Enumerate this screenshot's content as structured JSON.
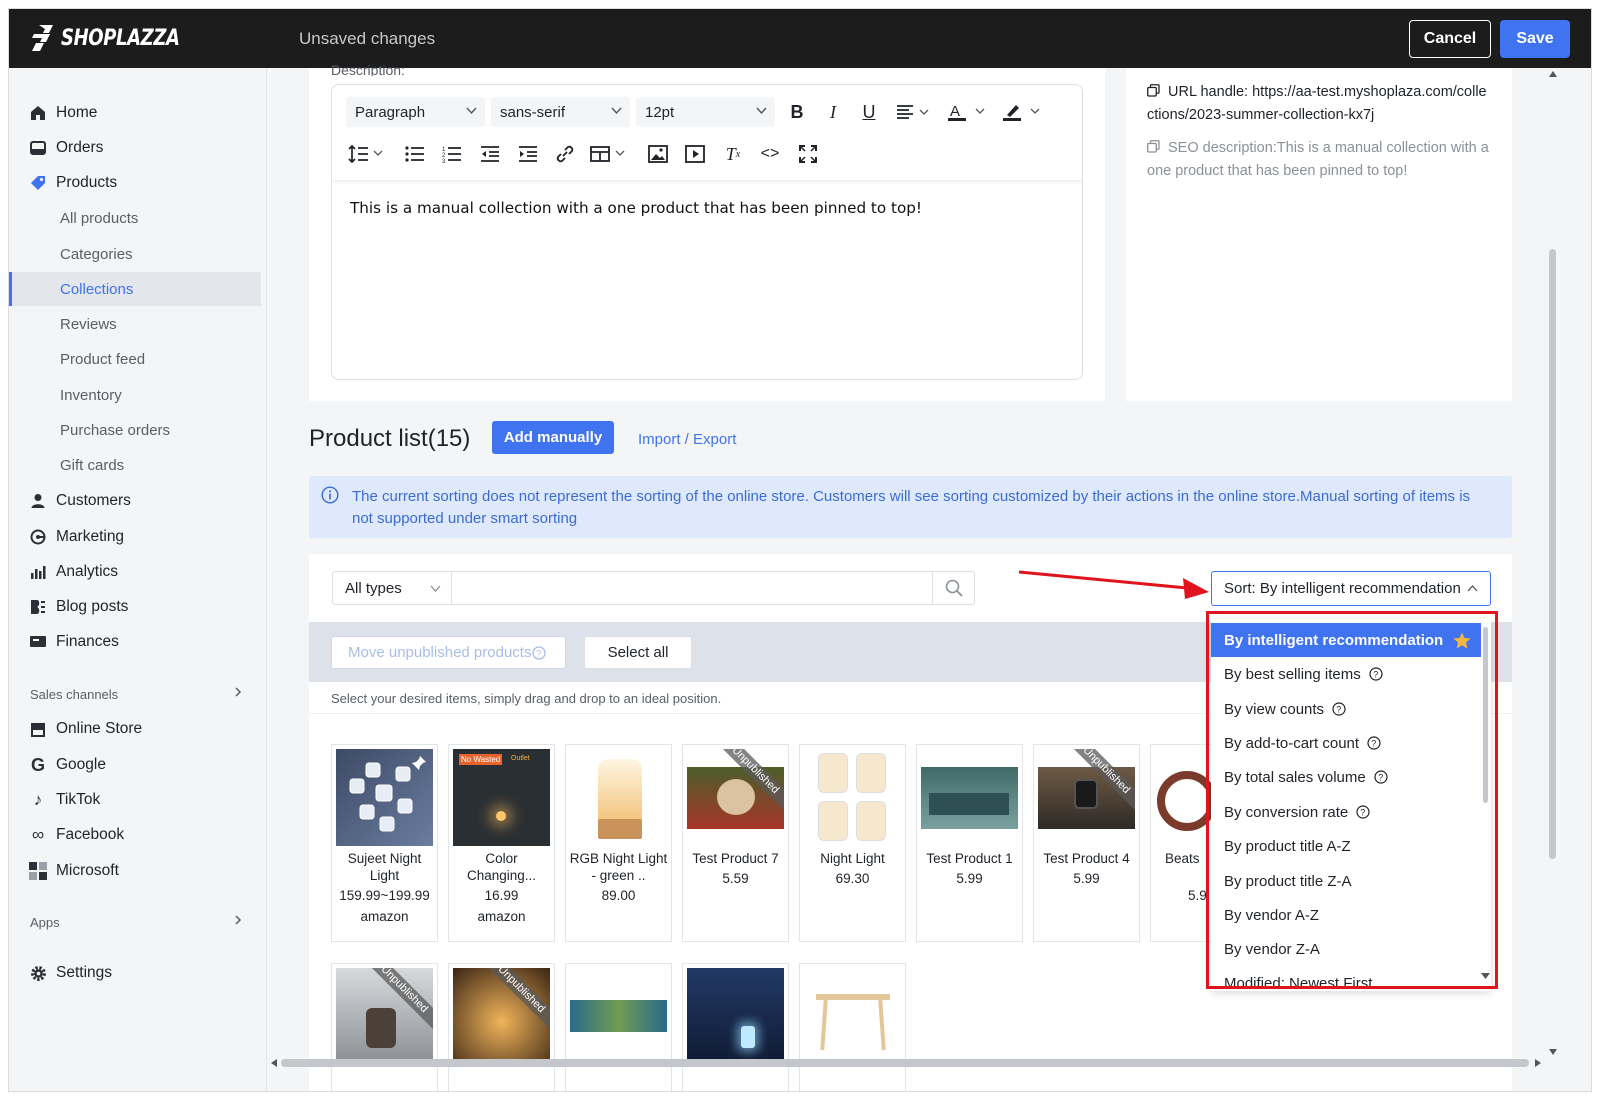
{
  "topbar": {
    "brand": "SHOPLAZZA",
    "status": "Unsaved changes",
    "cancel_label": "Cancel",
    "save_label": "Save"
  },
  "sidebar": {
    "items": [
      {
        "label": "Home",
        "icon": "home-icon"
      },
      {
        "label": "Orders",
        "icon": "orders-icon"
      },
      {
        "label": "Products",
        "icon": "tag-icon"
      }
    ],
    "product_sub": [
      "All products",
      "Categories",
      "Collections",
      "Reviews",
      "Product feed",
      "Inventory",
      "Purchase orders",
      "Gift cards"
    ],
    "active_sub": "Collections",
    "items2": [
      {
        "label": "Customers",
        "icon": "person-icon"
      },
      {
        "label": "Marketing",
        "icon": "marketing-icon"
      },
      {
        "label": "Analytics",
        "icon": "analytics-icon"
      },
      {
        "label": "Blog posts",
        "icon": "blog-icon"
      },
      {
        "label": "Finances",
        "icon": "finance-icon"
      }
    ],
    "sales_channels_label": "Sales channels",
    "channels": [
      {
        "label": "Online Store",
        "icon": "store-icon"
      },
      {
        "label": "Google",
        "icon": "google-icon"
      },
      {
        "label": "TikTok",
        "icon": "tiktok-icon"
      },
      {
        "label": "Facebook",
        "icon": "meta-icon"
      },
      {
        "label": "Microsoft",
        "icon": "microsoft-icon"
      }
    ],
    "apps_label": "Apps",
    "settings_label": "Settings"
  },
  "editor": {
    "description_label": "Description:",
    "block_format": "Paragraph",
    "font_family": "sans-serif",
    "font_size": "12pt",
    "content": "This is a manual collection with a one product that has been pinned to top!"
  },
  "seo": {
    "url_handle": "URL handle: https://aa-test.myshoplaza.com/collections/2023-summer-collection-kx7j",
    "seo_description": "SEO description:This is a manual collection with a one product that has been pinned to top!"
  },
  "product_list": {
    "title": "Product list(15)",
    "add_manually": "Add manually",
    "import_export": "Import / Export",
    "info": "The current sorting does not represent the sorting of the online store. Customers will see sorting customized by their actions in the online store.Manual sorting of items is not supported under smart sorting",
    "type_filter": "All types",
    "search_placeholder": "",
    "sort_label": "Sort: By intelligent recommendation",
    "move_unpublished": "Move unpublished products",
    "select_all": "Select all",
    "hint": "Select your desired items, simply drag and drop to an ideal position.",
    "unpublished_label": "Unpublished",
    "no_wasted_label": "No Wasted",
    "no_wasted_tag": "Outlet",
    "products": [
      {
        "name": "Sujeet Night Light",
        "price": "159.99~199.99",
        "vendor": "amazon"
      },
      {
        "name": "Color Changing...",
        "price": "16.99",
        "vendor": "amazon"
      },
      {
        "name": "RGB Night Light - green ..",
        "price": "89.00",
        "vendor": ""
      },
      {
        "name": "Test Product 7",
        "price": "5.59",
        "vendor": ""
      },
      {
        "name": "Night Light",
        "price": "69.30",
        "vendor": ""
      },
      {
        "name": "Test Product 1",
        "price": "5.99",
        "vendor": ""
      },
      {
        "name": "Test Product 4",
        "price": "5.99",
        "vendor": ""
      },
      {
        "name": "Beats",
        "price": "5.9",
        "vendor": ""
      }
    ]
  },
  "sort_options": [
    {
      "label": "By intelligent recommendation",
      "selected": true,
      "star": true,
      "help": false
    },
    {
      "label": "By best selling items",
      "selected": false,
      "help": true
    },
    {
      "label": "By view counts",
      "selected": false,
      "help": true
    },
    {
      "label": "By add-to-cart count",
      "selected": false,
      "help": true
    },
    {
      "label": "By total sales volume",
      "selected": false,
      "help": true
    },
    {
      "label": "By conversion rate",
      "selected": false,
      "help": true
    },
    {
      "label": "By product title A-Z",
      "selected": false,
      "help": false
    },
    {
      "label": "By product title Z-A",
      "selected": false,
      "help": false
    },
    {
      "label": "By vendor A-Z",
      "selected": false,
      "help": false
    },
    {
      "label": "By vendor Z-A",
      "selected": false,
      "help": false
    },
    {
      "label": "Modified: Newest First",
      "selected": false,
      "help": false
    }
  ],
  "colors": {
    "accent": "#3f73f0",
    "topbar": "#1c1c1c",
    "highlight": "#e0141c",
    "info_bg": "#dfe9fd"
  }
}
